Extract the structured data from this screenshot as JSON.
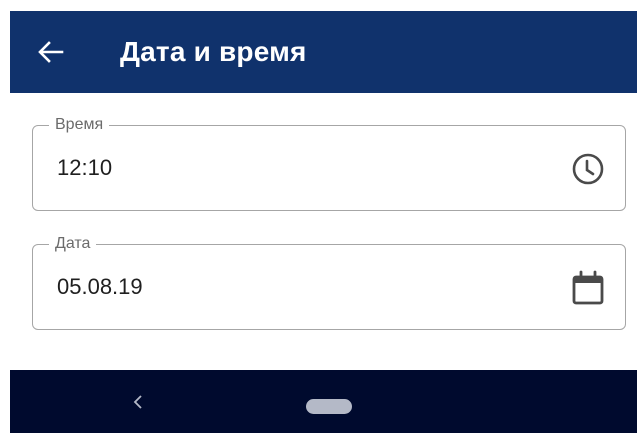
{
  "header": {
    "title": "Дата и время",
    "back_icon": "arrow-left-icon"
  },
  "fields": {
    "time": {
      "label": "Время",
      "value": "12:10",
      "icon": "clock-icon"
    },
    "date": {
      "label": "Дата",
      "value": "05.08.19",
      "icon": "calendar-icon"
    }
  },
  "navbar": {
    "back_icon": "chevron-left-icon",
    "home_icon": "home-pill-icon"
  },
  "colors": {
    "appbar": "#10326c",
    "navbar": "#000a2e",
    "border": "#a6a6a6",
    "icon": "#4a4a4a"
  }
}
